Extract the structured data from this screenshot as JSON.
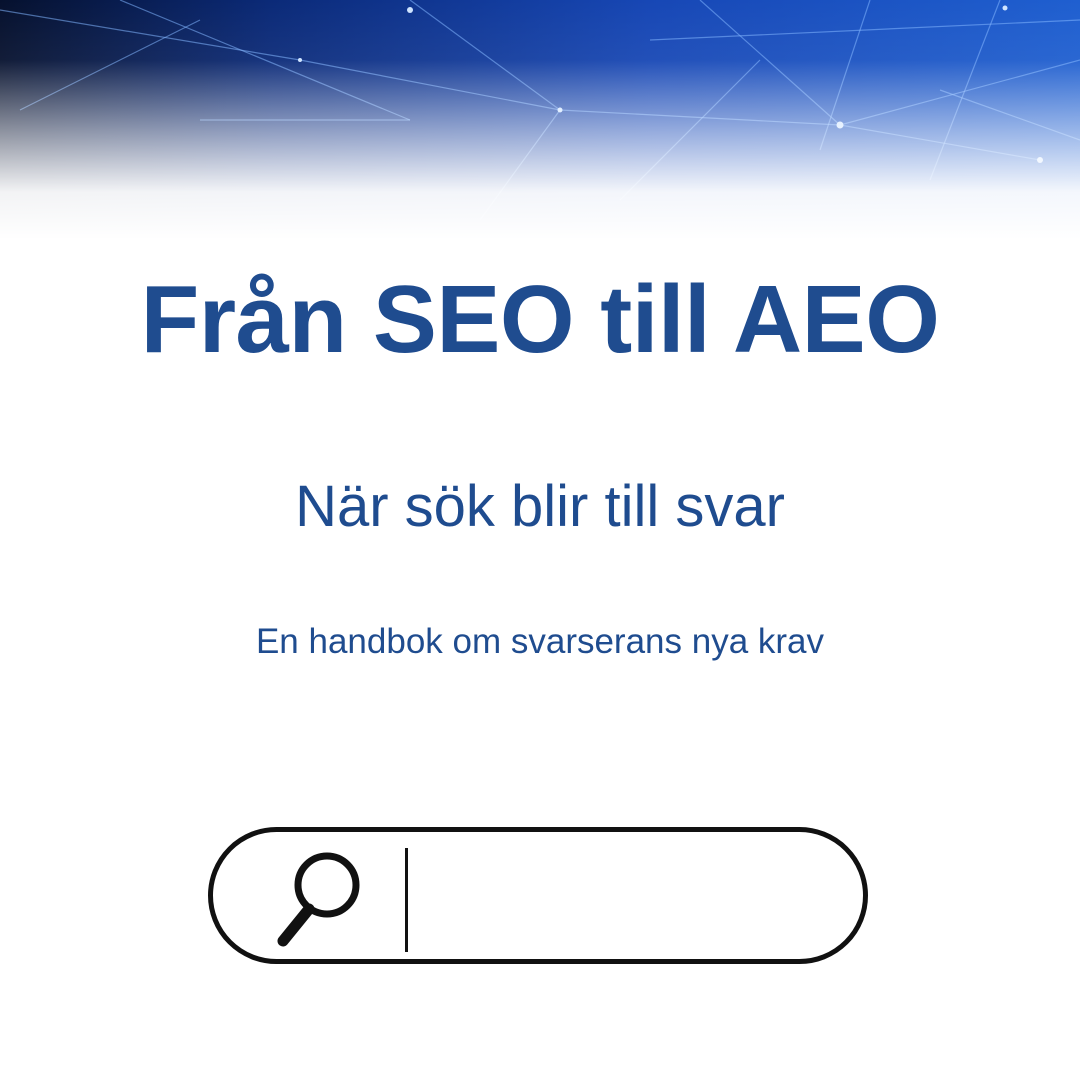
{
  "header": {
    "banner_image": "network-lines-banner",
    "colors": {
      "deep_blue": "#0a2f8f",
      "bright_blue": "#1f5fd0",
      "line_blue": "#7fb4ff",
      "fade_to": "#ffffff"
    }
  },
  "main": {
    "title": "Från SEO till AEO",
    "subtitle": "När sök blir till svar",
    "tagline": "En handbok om svarserans nya krav"
  },
  "search": {
    "icon": "search-icon",
    "value": "",
    "placeholder": ""
  },
  "theme": {
    "text_color": "#1f4c8f",
    "outline_color": "#111111",
    "background": "#ffffff"
  }
}
